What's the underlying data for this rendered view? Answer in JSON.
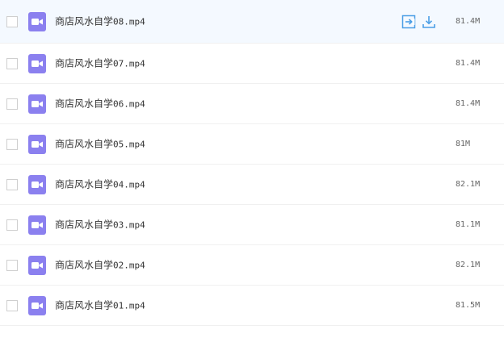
{
  "colors": {
    "accent": "#4a9ee6",
    "video_icon": "#8b80ef",
    "hover_row": "#f4f9ff"
  },
  "files": [
    {
      "name_cn": "商店风水自学",
      "name_suffix": "08.mp4",
      "size": "81.4M",
      "icon": "video-file-icon",
      "hovered": true
    },
    {
      "name_cn": "商店风水自学",
      "name_suffix": "07.mp4",
      "size": "81.4M",
      "icon": "video-file-icon"
    },
    {
      "name_cn": "商店风水自学",
      "name_suffix": "06.mp4",
      "size": "81.4M",
      "icon": "video-file-icon"
    },
    {
      "name_cn": "商店风水自学",
      "name_suffix": "05.mp4",
      "size": "81M",
      "icon": "video-file-icon"
    },
    {
      "name_cn": "商店风水自学",
      "name_suffix": "04.mp4",
      "size": "82.1M",
      "icon": "video-file-icon"
    },
    {
      "name_cn": "商店风水自学",
      "name_suffix": "03.mp4",
      "size": "81.1M",
      "icon": "video-file-icon"
    },
    {
      "name_cn": "商店风水自学",
      "name_suffix": "02.mp4",
      "size": "82.1M",
      "icon": "video-file-icon"
    },
    {
      "name_cn": "商店风水自学",
      "name_suffix": "01.mp4",
      "size": "81.5M",
      "icon": "video-file-icon"
    }
  ],
  "row_actions": {
    "share_icon": "share-to-icon",
    "download_icon": "download-icon"
  }
}
